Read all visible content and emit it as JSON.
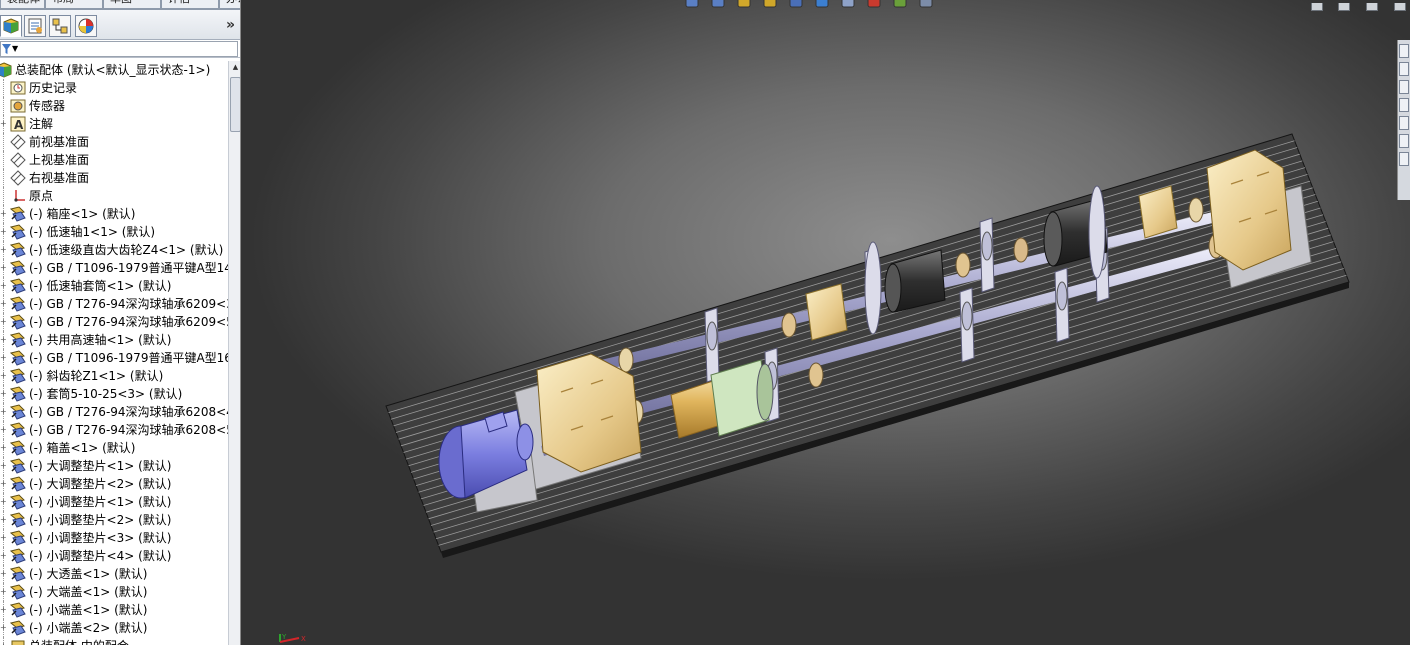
{
  "command_tabs": [
    "装配体",
    "布局",
    "草图",
    "评估",
    "办公室产品"
  ],
  "panel": {
    "tabs": [
      {
        "name": "featuremanager",
        "icon": "featuremanager-tree-icon"
      },
      {
        "name": "property",
        "icon": "property-manager-icon"
      },
      {
        "name": "config",
        "icon": "configuration-manager-icon"
      },
      {
        "name": "display",
        "icon": "display-manager-icon"
      }
    ],
    "expand_glyph": "»",
    "filter_glyph": "▼"
  },
  "tree": {
    "root": "总装配体  (默认<默认_显示状态-1>)",
    "items": [
      {
        "label": "历史记录",
        "kind": "history",
        "exp": false
      },
      {
        "label": "传感器",
        "kind": "sensor",
        "exp": false
      },
      {
        "label": "注解",
        "kind": "annotation",
        "exp": true
      },
      {
        "label": "前视基准面",
        "kind": "plane",
        "exp": false
      },
      {
        "label": "上视基准面",
        "kind": "plane",
        "exp": false
      },
      {
        "label": "右视基准面",
        "kind": "plane",
        "exp": false
      },
      {
        "label": "原点",
        "kind": "origin",
        "exp": false
      },
      {
        "label": "(-) 箱座<1> (默认)",
        "kind": "part",
        "exp": true
      },
      {
        "label": "(-) 低速轴1<1> (默认)",
        "kind": "part",
        "exp": true
      },
      {
        "label": "(-) 低速级直齿大齿轮Z4<1> (默认)",
        "kind": "part",
        "exp": true
      },
      {
        "label": "(-) GB / T1096-1979普通平键A型14",
        "kind": "part",
        "exp": true
      },
      {
        "label": "(-) 低速轴套筒<1> (默认)",
        "kind": "part",
        "exp": true
      },
      {
        "label": "(-) GB / T276-94深沟球轴承6209<3",
        "kind": "part",
        "exp": true
      },
      {
        "label": "(-) GB / T276-94深沟球轴承6209<5",
        "kind": "part",
        "exp": true
      },
      {
        "label": "(-) 共用高速轴<1> (默认)",
        "kind": "part",
        "exp": true
      },
      {
        "label": "(-) GB / T1096-1979普通平键A型16",
        "kind": "part",
        "exp": true
      },
      {
        "label": "(-) 斜齿轮Z1<1> (默认)",
        "kind": "part",
        "exp": true
      },
      {
        "label": "(-) 套筒5-10-25<3> (默认)",
        "kind": "part",
        "exp": true
      },
      {
        "label": "(-) GB / T276-94深沟球轴承6208<4",
        "kind": "part",
        "exp": true
      },
      {
        "label": "(-) GB / T276-94深沟球轴承6208<5",
        "kind": "part",
        "exp": true
      },
      {
        "label": "(-) 箱盖<1> (默认)",
        "kind": "part",
        "exp": true
      },
      {
        "label": "(-) 大调整垫片<1> (默认)",
        "kind": "part",
        "exp": true
      },
      {
        "label": "(-) 大调整垫片<2> (默认)",
        "kind": "part",
        "exp": true
      },
      {
        "label": "(-) 小调整垫片<1> (默认)",
        "kind": "part",
        "exp": true
      },
      {
        "label": "(-) 小调整垫片<2> (默认)",
        "kind": "part",
        "exp": true
      },
      {
        "label": "(-) 小调整垫片<3> (默认)",
        "kind": "part",
        "exp": true
      },
      {
        "label": "(-) 小调整垫片<4> (默认)",
        "kind": "part",
        "exp": true
      },
      {
        "label": "(-) 大透盖<1> (默认)",
        "kind": "part",
        "exp": true
      },
      {
        "label": "(-) 大端盖<1> (默认)",
        "kind": "part",
        "exp": true
      },
      {
        "label": "(-) 小端盖<1> (默认)",
        "kind": "part",
        "exp": true
      },
      {
        "label": "(-) 小端盖<2> (默认)",
        "kind": "part",
        "exp": true
      },
      {
        "label": "总装配体 中的配合",
        "kind": "mates",
        "exp": true
      }
    ]
  },
  "hud_icons": [
    "zoom-to-fit-icon",
    "zoom-area-icon",
    "previous-view-icon",
    "section-view-icon",
    "view-orientation-icon",
    "display-style-icon",
    "hide-show-icon",
    "edit-appearance-icon",
    "apply-scene-icon",
    "view-settings-icon"
  ],
  "triad": {
    "x": "X",
    "y": "Y"
  },
  "colors": {
    "motor": "#7b7ee0",
    "gearbox": "#e8cf8f",
    "shaft": "#b9b9d9",
    "base": "#2e2e2e",
    "support": "#d9d9e8",
    "coupling": "#d8a455",
    "brake": "#3a3a3a"
  }
}
